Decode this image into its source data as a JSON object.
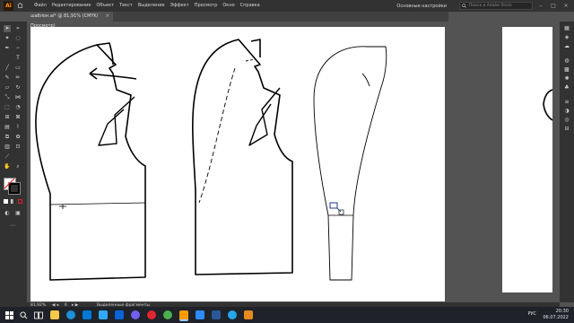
{
  "app": {
    "logo": "Ai"
  },
  "menu": [
    "Файл",
    "Редактирование",
    "Объект",
    "Текст",
    "Выделение",
    "Эффект",
    "Просмотр",
    "Окно",
    "Справка"
  ],
  "header": {
    "workspace": "Основные настройки",
    "search_placeholder": "Поиск в Adobe Stock"
  },
  "tab": {
    "title": "шаблон.ai* @ 81,91% (CMYK/Просмотр)",
    "close": "×"
  },
  "status": {
    "zoom": "81,92%",
    "page": "6",
    "tool": "Выделенные фрагменты"
  },
  "clock": {
    "time": "20:30",
    "date": "06.07.2022"
  },
  "tray": {
    "lang": "РУС"
  },
  "icons": {
    "home": "home-icon",
    "window_buttons": [
      "minimize-icon",
      "maximize-icon",
      "close-icon"
    ],
    "taskbar": [
      "windows-start-icon",
      "search-icon",
      "task-view-icon",
      "file-explorer-icon",
      "edge-icon",
      "store-icon",
      "photoshop-icon",
      "mail-icon",
      "viber-icon",
      "opera-icon",
      "chrome-icon",
      "illustrator-icon",
      "zoom-icon",
      "word-icon",
      "telegram-icon",
      "media-icon"
    ]
  },
  "colors": {
    "taskbar_apps": [
      "#ffffff",
      "#ffffff",
      "#ffffff",
      "#f7c948",
      "#1e8fd8",
      "#0078d7",
      "#31a8ff",
      "#0a64d6",
      "#7360f2",
      "#e0262f",
      "#4caf50",
      "#ff9a00",
      "#2d8cff",
      "#2b579a",
      "#27a7e7",
      "#e58a1f"
    ]
  }
}
